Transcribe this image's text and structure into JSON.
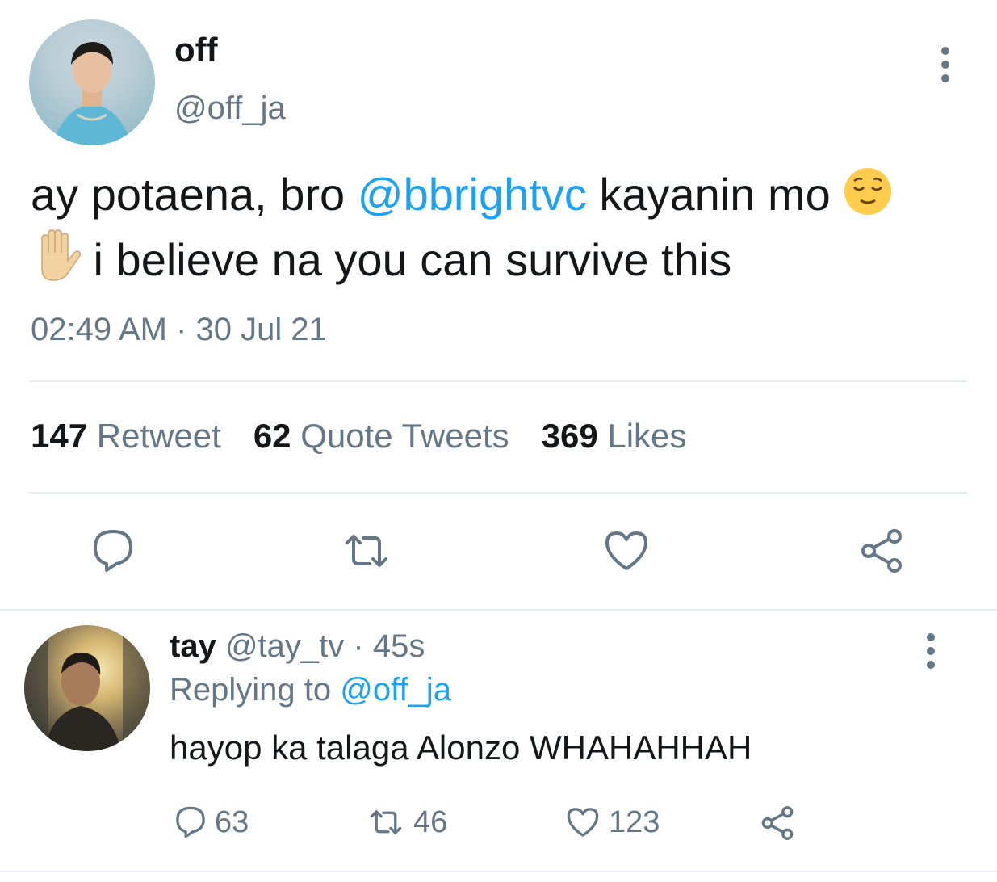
{
  "tweet": {
    "author_name": "off",
    "author_handle": "@off_ja",
    "text_part1": "ay potaena, bro ",
    "mention": "@bbrightvc",
    "text_part2": " kayanin mo ",
    "text_part3": " i believe na you can survive this",
    "emoji_1": "relieved-face",
    "emoji_2": "raised-hand",
    "timestamp": "02:49 AM · 30 Jul 21",
    "stats": {
      "retweets_count": "147",
      "retweets_label": "Retweet",
      "quotes_count": "62",
      "quotes_label": "Quote Tweets",
      "likes_count": "369",
      "likes_label": "Likes"
    },
    "actions": [
      "reply-icon",
      "retweet-icon",
      "like-icon",
      "share-icon"
    ]
  },
  "reply": {
    "author_name": "tay",
    "author_handle": "@tay_tv",
    "time": "· 45s",
    "replying_label": "Replying to",
    "replying_to": "@off_ja",
    "text": "hayop ka talaga Alonzo WHAHAHHAH",
    "reply_count": "63",
    "retweet_count": "46",
    "like_count": "123"
  },
  "colors": {
    "accent": "#1da1f2",
    "secondary_text": "#657786",
    "primary_text": "#14171a",
    "divider": "#e6ecf0"
  }
}
